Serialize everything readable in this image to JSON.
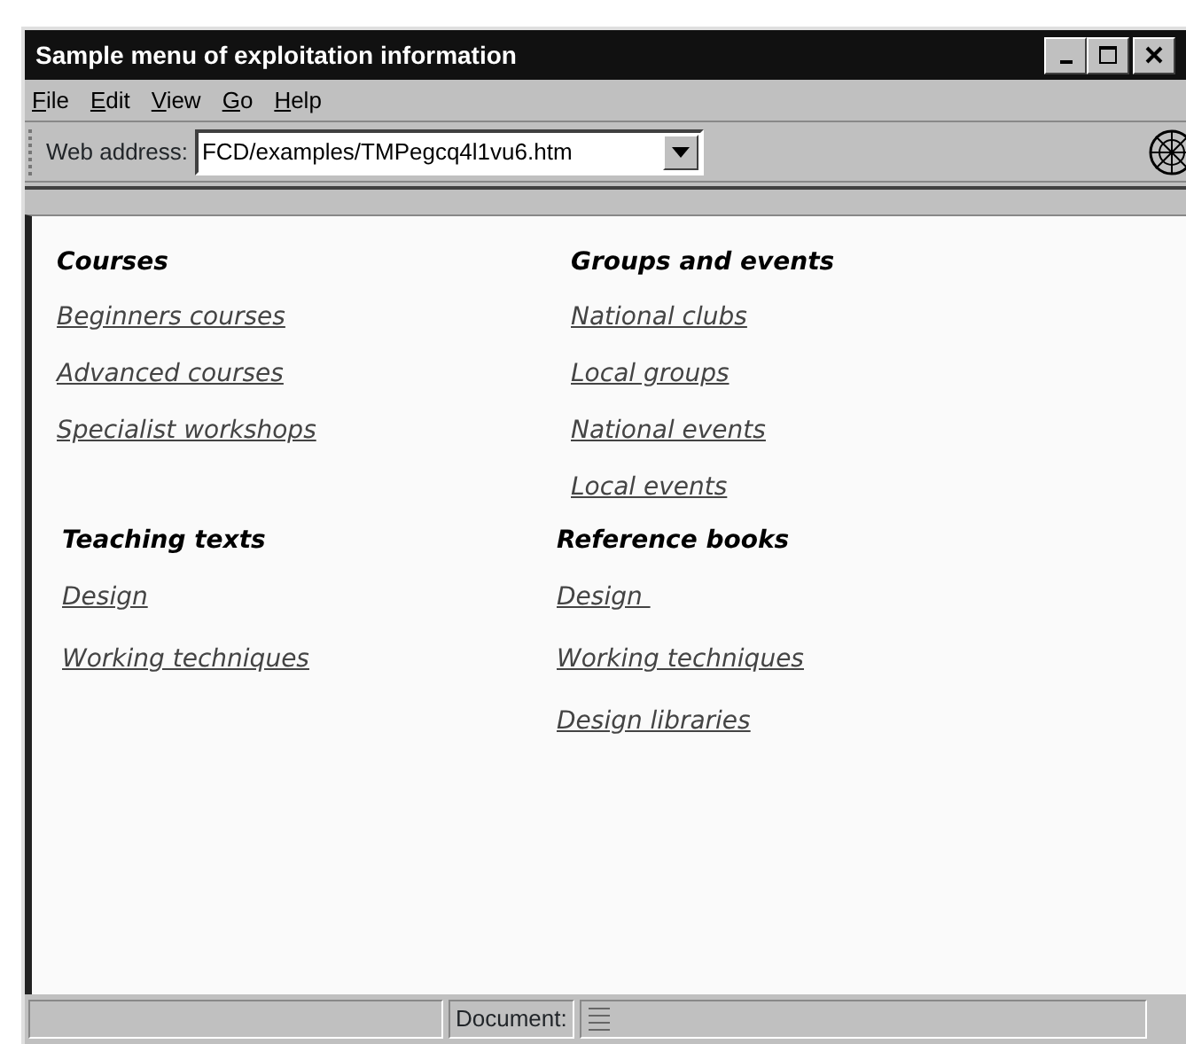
{
  "window": {
    "title": "Sample menu of exploitation information"
  },
  "menu": [
    "File",
    "Edit",
    "View",
    "Go",
    "Help"
  ],
  "address_bar": {
    "label": "Web address:",
    "value": "FCD/examples/TMPegcq4l1vu6.htm"
  },
  "sections": [
    {
      "heading": "Courses",
      "links": [
        "Beginners courses",
        "Advanced courses",
        "Specialist workshops"
      ]
    },
    {
      "heading": "Groups and events",
      "links": [
        "National clubs",
        "Local groups",
        "National events",
        "Local events"
      ]
    },
    {
      "heading": "Teaching texts",
      "links": [
        "Design",
        "Working techniques"
      ]
    },
    {
      "heading": "Reference books",
      "links": [
        "Design ",
        "Working techniques",
        "Design libraries"
      ]
    }
  ],
  "status_bar": {
    "document_label": "Document:"
  }
}
